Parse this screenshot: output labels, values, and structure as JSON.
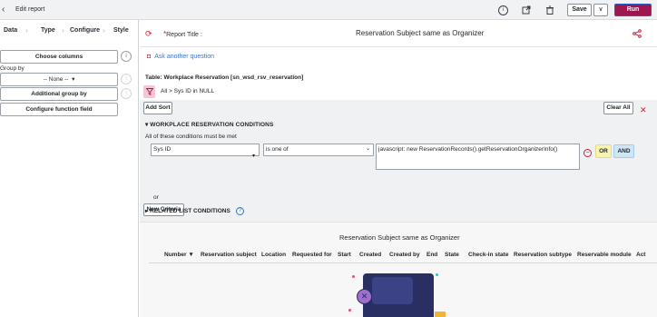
{
  "header": {
    "back_icon": "chevron-left-icon",
    "title": "Edit report",
    "save_label": "Save",
    "save_dropdown_glyph": "∨",
    "run_label": "Run",
    "colors": {
      "run_bg": "#9d1750",
      "header_bg": "#f1f2f4"
    }
  },
  "left": {
    "steps": [
      "Data",
      "Type",
      "Configure",
      "Style"
    ],
    "choose_columns": "Choose columns",
    "group_by_label": "Group by",
    "group_by_value": "-- None --",
    "additional_group_by": "Additional group by",
    "configure_function_field": "Configure function field"
  },
  "main": {
    "report_title_label": "Report Title :",
    "report_title_value": "Reservation Subject same as Organizer",
    "ask_another_question": "Ask another question",
    "table_label": "Table: Workplace Reservation [sn_wsd_rsv_reservation]",
    "breadcrumb": "All > Sys ID in NULL",
    "add_sort": "Add Sort",
    "clear_all": "Clear All",
    "section_title": "WORKPLACE RESERVATION CONDITIONS",
    "section_subtitle": "All of these conditions must be met",
    "condition": {
      "field": "Sys ID",
      "operator": "is one of",
      "value": "javascript: new ReservationRecords().getReservationOrganizerInfo()"
    },
    "or_button": "OR",
    "and_button": "AND",
    "or_label": "or",
    "new_criteria": "New Criteria",
    "related_list_conditions": "RELATED LIST CONDITIONS"
  },
  "preview": {
    "title": "Reservation Subject same as Organizer",
    "columns": [
      "Number",
      "Reservation subject",
      "Location",
      "Requested for",
      "Start",
      "Created",
      "Created by",
      "End",
      "State",
      "Check-in state",
      "Reservation subtype",
      "Reservable module",
      "Act"
    ],
    "sort_indicator": "▼"
  }
}
